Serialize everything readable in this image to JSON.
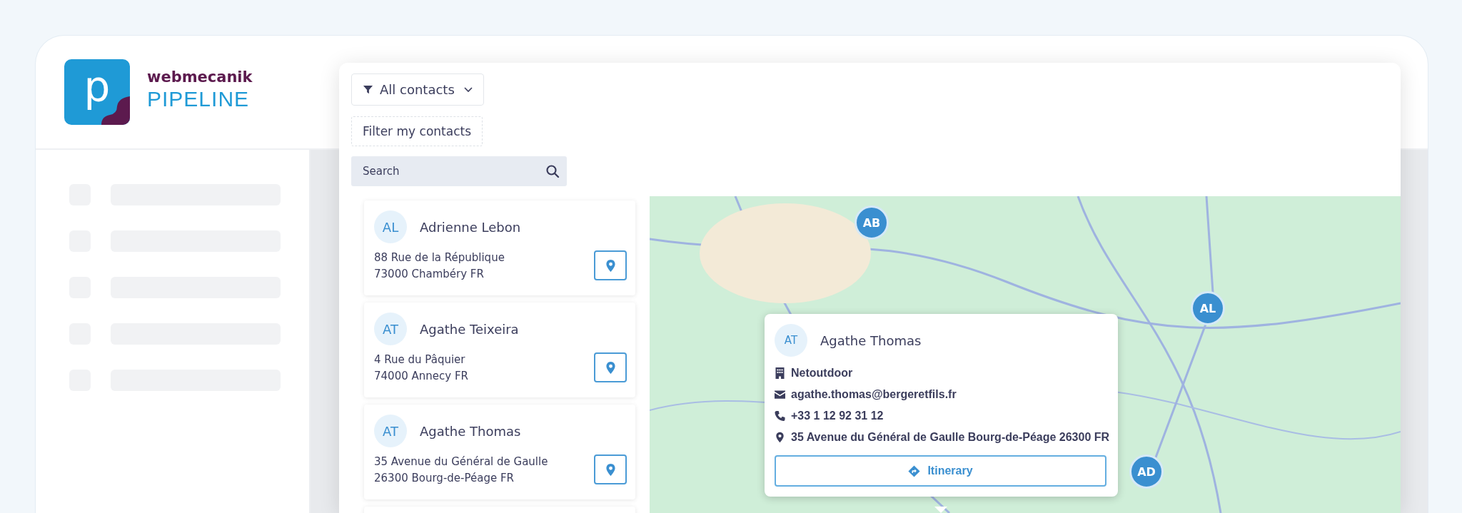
{
  "brand": {
    "company": "webmecanik",
    "product": "PIPELINE",
    "logo_letter": "p"
  },
  "sidebar": {
    "items": [
      {
        "kind": "skeleton"
      },
      {
        "kind": "skeleton"
      },
      {
        "kind": "skeleton"
      },
      {
        "kind": "skeleton"
      },
      {
        "kind": "skeleton"
      }
    ]
  },
  "filter_dropdown": {
    "label": "All contacts"
  },
  "filter_button": {
    "label": "Filter my contacts"
  },
  "search": {
    "placeholder": "Search"
  },
  "contacts": [
    {
      "initials": "AL",
      "name": "Adrienne Lebon",
      "address_line_1": "88 Rue de la République",
      "address_line_2": "73000 Chambéry FR"
    },
    {
      "initials": "AT",
      "name": "Agathe Teixeira",
      "address_line_1": "4 Rue du Pâquier",
      "address_line_2": "74000 Annecy FR"
    },
    {
      "initials": "AT",
      "name": "Agathe Thomas",
      "address_line_1": "35 Avenue du Général de Gaulle",
      "address_line_2": "26300 Bourg-de-Péage FR"
    }
  ],
  "map": {
    "markers": [
      {
        "initials": "AB"
      },
      {
        "initials": "AL"
      },
      {
        "initials": "AD"
      }
    ],
    "popup": {
      "initials": "AT",
      "name": "Agathe Thomas",
      "company": "Netoutdoor",
      "email": "agathe.thomas@bergeretfils.fr",
      "phone": "+33 1 12 92 31 12",
      "address": "35 Avenue du Général de Gaulle Bourg-de-Péage 26300 FR",
      "button": "Itinerary"
    }
  }
}
